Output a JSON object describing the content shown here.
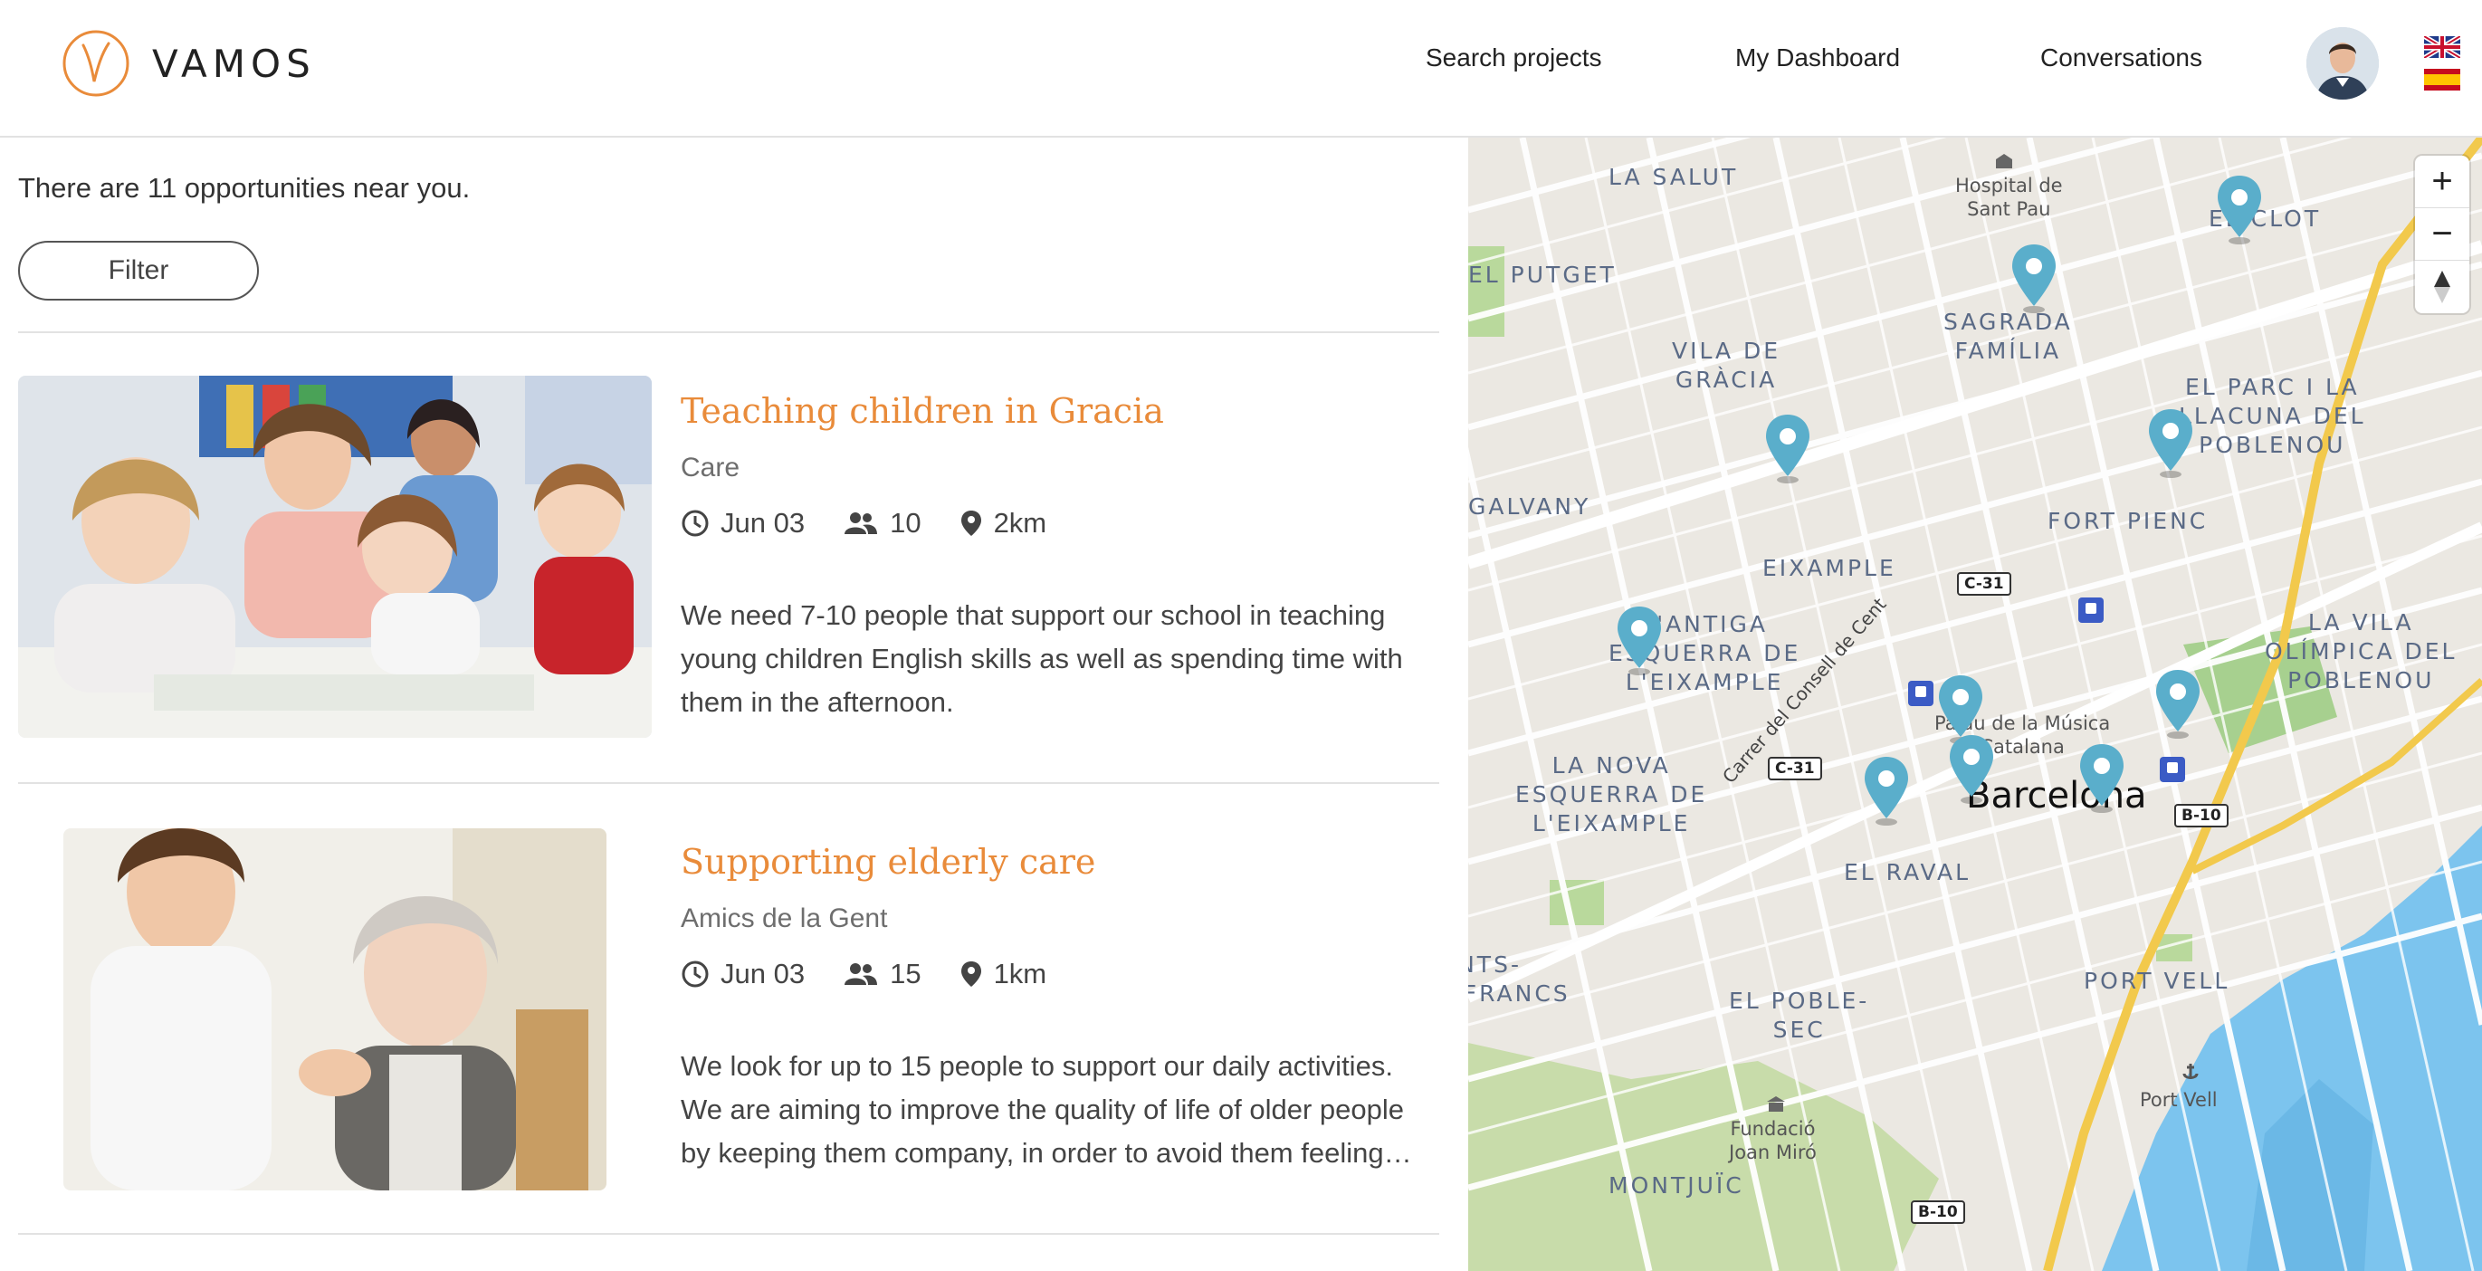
{
  "header": {
    "brand": "VAMOS",
    "nav": [
      "Search projects",
      "My Dashboard",
      "Conversations"
    ],
    "languages": [
      "English",
      "Español"
    ]
  },
  "list": {
    "count_text": "There are 11 opportunities near you.",
    "filter_label": "Filter",
    "cards": [
      {
        "title": "Teaching children in Gracia",
        "org": "Care",
        "date": "Jun 03",
        "people": "10",
        "distance": "2km",
        "description": "We need 7-10 people that support our school in teaching young children English skills as well as spending time with them in the afternoon."
      },
      {
        "title": "Supporting elderly care",
        "org": "Amics de la Gent",
        "date": "Jun 03",
        "people": "15",
        "distance": "1km",
        "description": "We look for up to 15 people to support our daily activities. We are aiming to improve the quality of life of older people by keeping them company, in order to avoid them feeling…"
      }
    ]
  },
  "map": {
    "districts": [
      "LA SALUT",
      "EL PUTGET",
      "VILA DE\nGRÀCIA",
      "SAGRADA\nFAMÍLIA",
      "EL CLOT",
      "EL PARC I LA\nLLACUNA DEL\nPOBLENOU",
      "GALVANY",
      "FORT PIENC",
      "EIXAMPLE",
      "LA VILA\nOLÍMPICA DEL\nPOBLENOU",
      "L'ANTIGA\nESQUERRA DE\nL'EIXAMPLE",
      "LA NOVA\nESQUERRA DE\nL'EIXAMPLE",
      "EL RAVAL",
      "SANTS-\nHOSTAFRANCS",
      "EL POBLE-\nSEC",
      "PORT VELL",
      "MONTJUÏC"
    ],
    "pois": [
      "Hospital de\nSant Pau",
      "Palau de la Música\nCatalana",
      "Port Vell",
      "Fundació\nJoan Miró"
    ],
    "city": "Barcelona",
    "roads": [
      "C-31",
      "C-31",
      "B-10",
      "B-10"
    ],
    "street": "Carrer del Consell de Cent",
    "zoom_in": "+",
    "zoom_out": "−",
    "pin_color": "#5aaecb"
  }
}
